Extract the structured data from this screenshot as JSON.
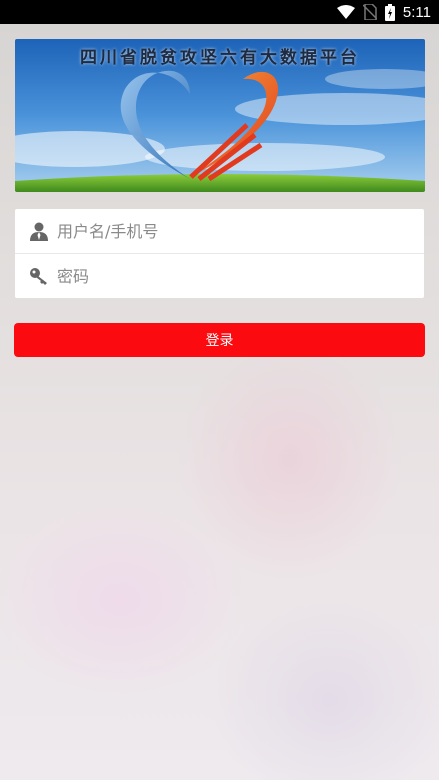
{
  "status_bar": {
    "time": "5:11",
    "icons": [
      "wifi-icon",
      "no-sim-icon",
      "battery-icon"
    ]
  },
  "banner": {
    "title": "四川省脱贫攻坚六有大数据平台"
  },
  "login": {
    "username_placeholder": "用户名/手机号",
    "password_placeholder": "密码",
    "username_value": "",
    "password_value": "",
    "submit_label": "登录"
  },
  "colors": {
    "button": "#fb0a10",
    "status_bar": "#000000"
  }
}
